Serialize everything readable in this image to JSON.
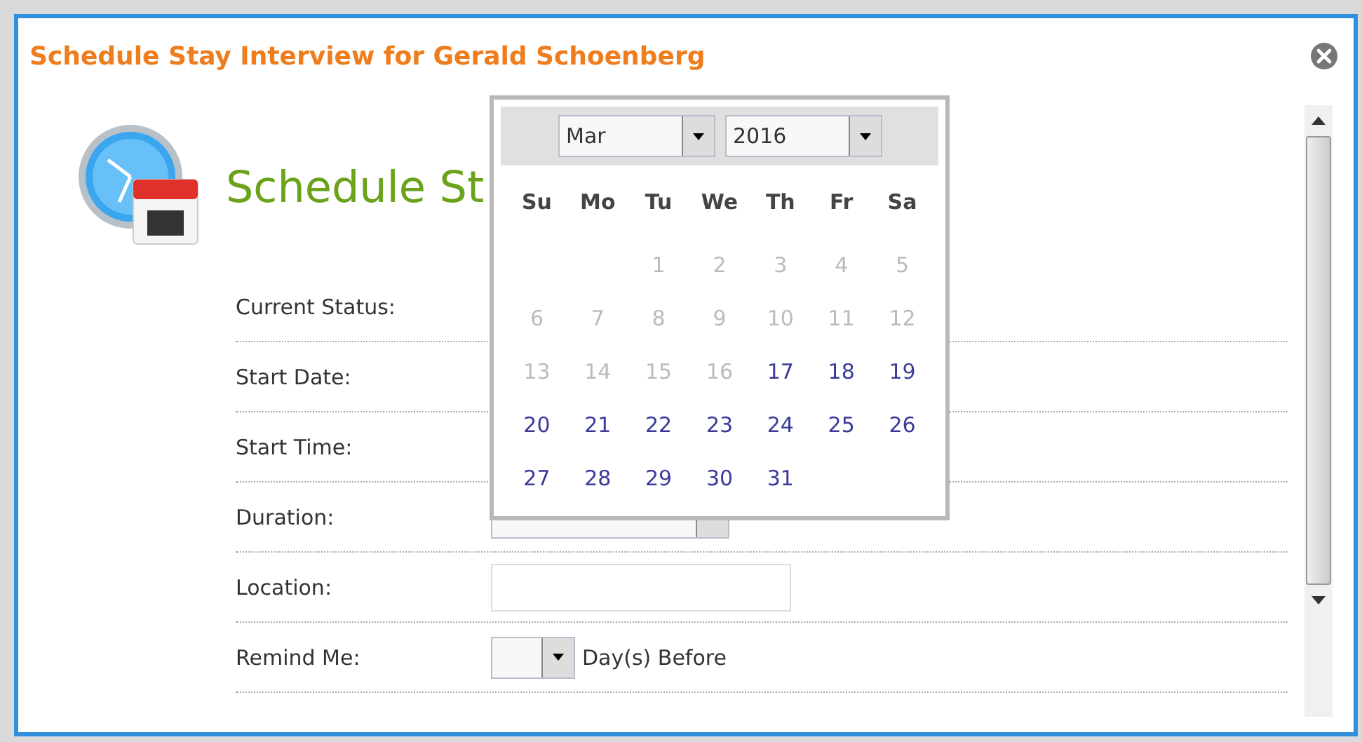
{
  "dialog": {
    "title": "Schedule Stay Interview for Gerald Schoenberg"
  },
  "heading": "Schedule St",
  "form": [
    {
      "label": "Current Status:",
      "kind": "covered"
    },
    {
      "label": "Start Date:",
      "kind": "covered"
    },
    {
      "label": "Start Time:",
      "kind": "covered"
    },
    {
      "label": "Duration:",
      "kind": "select"
    },
    {
      "label": "Location:",
      "kind": "input"
    },
    {
      "label": "Remind Me:",
      "kind": "select_suffix",
      "suffix": "Day(s) Before"
    }
  ],
  "calendar": {
    "month": "Mar",
    "year": "2016",
    "weekdays": [
      "Su",
      "Mo",
      "Tu",
      "We",
      "Th",
      "Fr",
      "Sa"
    ],
    "weeks": [
      [
        {
          "label": "1",
          "disabled": true
        },
        {
          "label": "2",
          "disabled": true
        },
        {
          "label": "3",
          "disabled": true
        },
        {
          "label": "4",
          "disabled": true
        },
        {
          "label": "5",
          "disabled": true
        }
      ],
      [
        {
          "label": "6",
          "disabled": true
        },
        {
          "label": "7",
          "disabled": true
        },
        {
          "label": "8",
          "disabled": true
        },
        {
          "label": "9",
          "disabled": true
        },
        {
          "label": "10",
          "disabled": true
        },
        {
          "label": "11",
          "disabled": true
        },
        {
          "label": "12",
          "disabled": true
        }
      ],
      [
        {
          "label": "13",
          "disabled": true
        },
        {
          "label": "14",
          "disabled": true
        },
        {
          "label": "15",
          "disabled": true
        },
        {
          "label": "16",
          "disabled": true
        },
        {
          "label": "17",
          "disabled": false
        },
        {
          "label": "18",
          "disabled": false
        },
        {
          "label": "19",
          "disabled": false
        }
      ],
      [
        {
          "label": "20",
          "disabled": false
        },
        {
          "label": "21",
          "disabled": false
        },
        {
          "label": "22",
          "disabled": false
        },
        {
          "label": "23",
          "disabled": false
        },
        {
          "label": "24",
          "disabled": false
        },
        {
          "label": "25",
          "disabled": false
        },
        {
          "label": "26",
          "disabled": false
        }
      ],
      [
        {
          "label": "27",
          "disabled": false
        },
        {
          "label": "28",
          "disabled": false
        },
        {
          "label": "29",
          "disabled": false
        },
        {
          "label": "30",
          "disabled": false
        },
        {
          "label": "31",
          "disabled": false
        }
      ]
    ]
  }
}
